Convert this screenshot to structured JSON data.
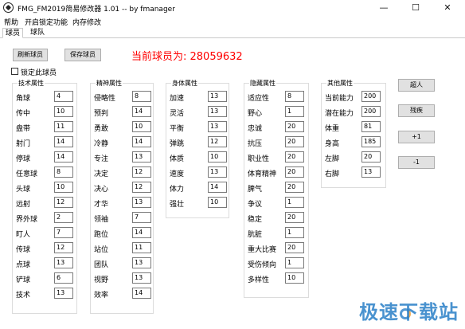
{
  "window": {
    "title": "FMG_FM2019简易修改器 1.01 -- by fmanager",
    "min": "—",
    "max": "☐",
    "close": "✕"
  },
  "menu": [
    "帮助",
    "开启锁定功能",
    "内存修改"
  ],
  "tabs": [
    "球员",
    "球队"
  ],
  "buttons": {
    "refresh": "刷新球员",
    "save": "保存球员",
    "super": "超人",
    "weak": "残疾",
    "plus": "+1",
    "minus": "-1"
  },
  "current_player": "当前球员为: 28059632",
  "lock_label": "锁定此球员",
  "groups": {
    "technical": {
      "title": "技术属性",
      "rows": [
        {
          "label": "角球",
          "value": "4"
        },
        {
          "label": "传中",
          "value": "10"
        },
        {
          "label": "盘带",
          "value": "11"
        },
        {
          "label": "射门",
          "value": "14"
        },
        {
          "label": "停球",
          "value": "14"
        },
        {
          "label": "任意球",
          "value": "8"
        },
        {
          "label": "头球",
          "value": "10"
        },
        {
          "label": "远射",
          "value": "12"
        },
        {
          "label": "界外球",
          "value": "2"
        },
        {
          "label": "盯人",
          "value": "7"
        },
        {
          "label": "传球",
          "value": "12"
        },
        {
          "label": "点球",
          "value": "13"
        },
        {
          "label": "铲球",
          "value": "6"
        },
        {
          "label": "技术",
          "value": "13"
        }
      ]
    },
    "mental": {
      "title": "精神属性",
      "rows": [
        {
          "label": "侵略性",
          "value": "8"
        },
        {
          "label": "预判",
          "value": "14"
        },
        {
          "label": "勇敢",
          "value": "10"
        },
        {
          "label": "冷静",
          "value": "14"
        },
        {
          "label": "专注",
          "value": "13"
        },
        {
          "label": "决定",
          "value": "12"
        },
        {
          "label": "决心",
          "value": "12"
        },
        {
          "label": "才华",
          "value": "13"
        },
        {
          "label": "领袖",
          "value": "7"
        },
        {
          "label": "跑位",
          "value": "14"
        },
        {
          "label": "站位",
          "value": "11"
        },
        {
          "label": "团队",
          "value": "13"
        },
        {
          "label": "视野",
          "value": "13"
        },
        {
          "label": "效率",
          "value": "14"
        }
      ]
    },
    "physical": {
      "title": "身体属性",
      "rows": [
        {
          "label": "加速",
          "value": "13"
        },
        {
          "label": "灵活",
          "value": "13"
        },
        {
          "label": "平衡",
          "value": "13"
        },
        {
          "label": "弹跳",
          "value": "12"
        },
        {
          "label": "体质",
          "value": "10"
        },
        {
          "label": "速度",
          "value": "13"
        },
        {
          "label": "体力",
          "value": "14"
        },
        {
          "label": "强壮",
          "value": "10"
        }
      ]
    },
    "hidden": {
      "title": "隐藏属性",
      "rows": [
        {
          "label": "适应性",
          "value": "8"
        },
        {
          "label": "野心",
          "value": "1"
        },
        {
          "label": "忠诚",
          "value": "20"
        },
        {
          "label": "抗压",
          "value": "20"
        },
        {
          "label": "职业性",
          "value": "20"
        },
        {
          "label": "体育精神",
          "value": "20"
        },
        {
          "label": "脾气",
          "value": "20"
        },
        {
          "label": "争议",
          "value": "1"
        },
        {
          "label": "稳定",
          "value": "20"
        },
        {
          "label": "肮脏",
          "value": "1"
        },
        {
          "label": "重大比赛",
          "value": "20"
        },
        {
          "label": "受伤倾向",
          "value": "1"
        },
        {
          "label": "多样性",
          "value": "10"
        }
      ]
    },
    "other": {
      "title": "其他属性",
      "rows": [
        {
          "label": "当前能力",
          "value": "200"
        },
        {
          "label": "潜在能力",
          "value": "200"
        },
        {
          "label": "体重",
          "value": "81"
        },
        {
          "label": "身高",
          "value": "185"
        },
        {
          "label": "左脚",
          "value": "20"
        },
        {
          "label": "右脚",
          "value": "13"
        }
      ]
    }
  },
  "watermark": "极速下载站"
}
